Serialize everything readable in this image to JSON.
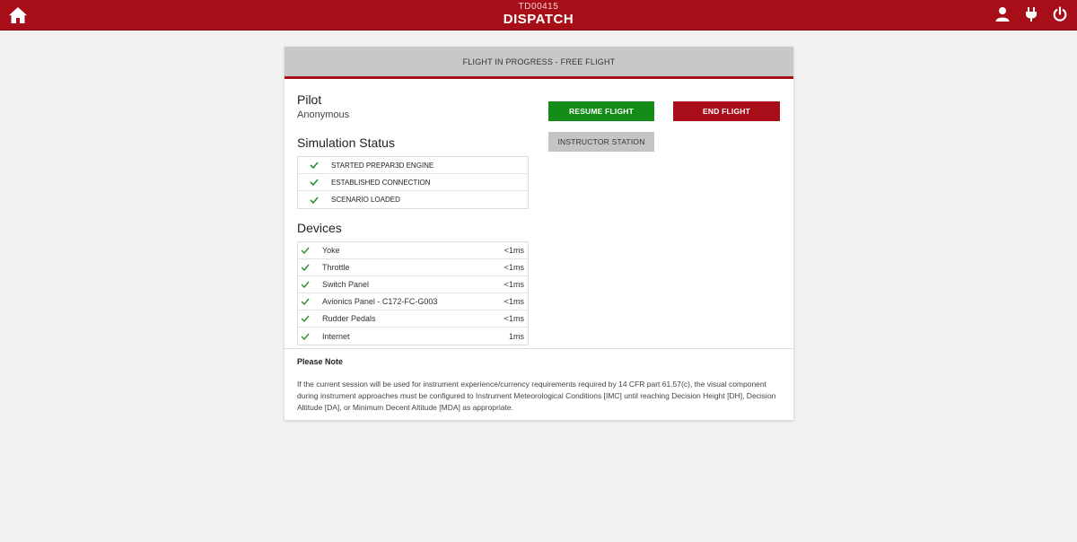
{
  "topbar": {
    "code": "TD00415",
    "title": "DISPATCH",
    "icons": [
      "home-icon",
      "user-icon",
      "plug-icon",
      "power-icon"
    ]
  },
  "card": {
    "header": "FLIGHT IN PROGRESS - FREE FLIGHT",
    "pilot": {
      "title": "Pilot",
      "name": "Anonymous"
    },
    "simulation": {
      "title": "Simulation Status",
      "items": [
        {
          "label": "STARTED PREPAR3D ENGINE",
          "status": "ok"
        },
        {
          "label": "ESTABLISHED CONNECTION",
          "status": "ok"
        },
        {
          "label": "SCENARIO LOADED",
          "status": "ok"
        }
      ]
    },
    "devices": {
      "title": "Devices",
      "items": [
        {
          "name": "Yoke",
          "latency": "<1ms",
          "status": "ok"
        },
        {
          "name": "Throttle",
          "latency": "<1ms",
          "status": "ok"
        },
        {
          "name": "Switch Panel",
          "latency": "<1ms",
          "status": "ok"
        },
        {
          "name": "Avionics Panel - C172-FC-G003",
          "latency": "<1ms",
          "status": "ok"
        },
        {
          "name": "Rudder Pedals",
          "latency": "<1ms",
          "status": "ok"
        },
        {
          "name": "Internet",
          "latency": "1ms",
          "status": "ok"
        }
      ]
    },
    "buttons": {
      "resume": "RESUME FLIGHT",
      "end": "END FLIGHT",
      "instructor": "INSTRUCTOR STATION"
    },
    "note": {
      "title": "Please Note",
      "text": "If the current session will be used for instrument experience/currency requirements required by 14 CFR part 61.57(c), the visual component during instrument approaches must be configured to Instrument Meteorological Conditions [IMC] until reaching Decision Height [DH], Decision Altitude [DA], or Minimum Decent Altitude [MDA] as appropriate."
    }
  },
  "colors": {
    "brand": "#a80e17",
    "success": "#138b17",
    "check": "#2e8b2e",
    "header_gray": "#c8c8c8",
    "background": "#f1f1f1"
  }
}
